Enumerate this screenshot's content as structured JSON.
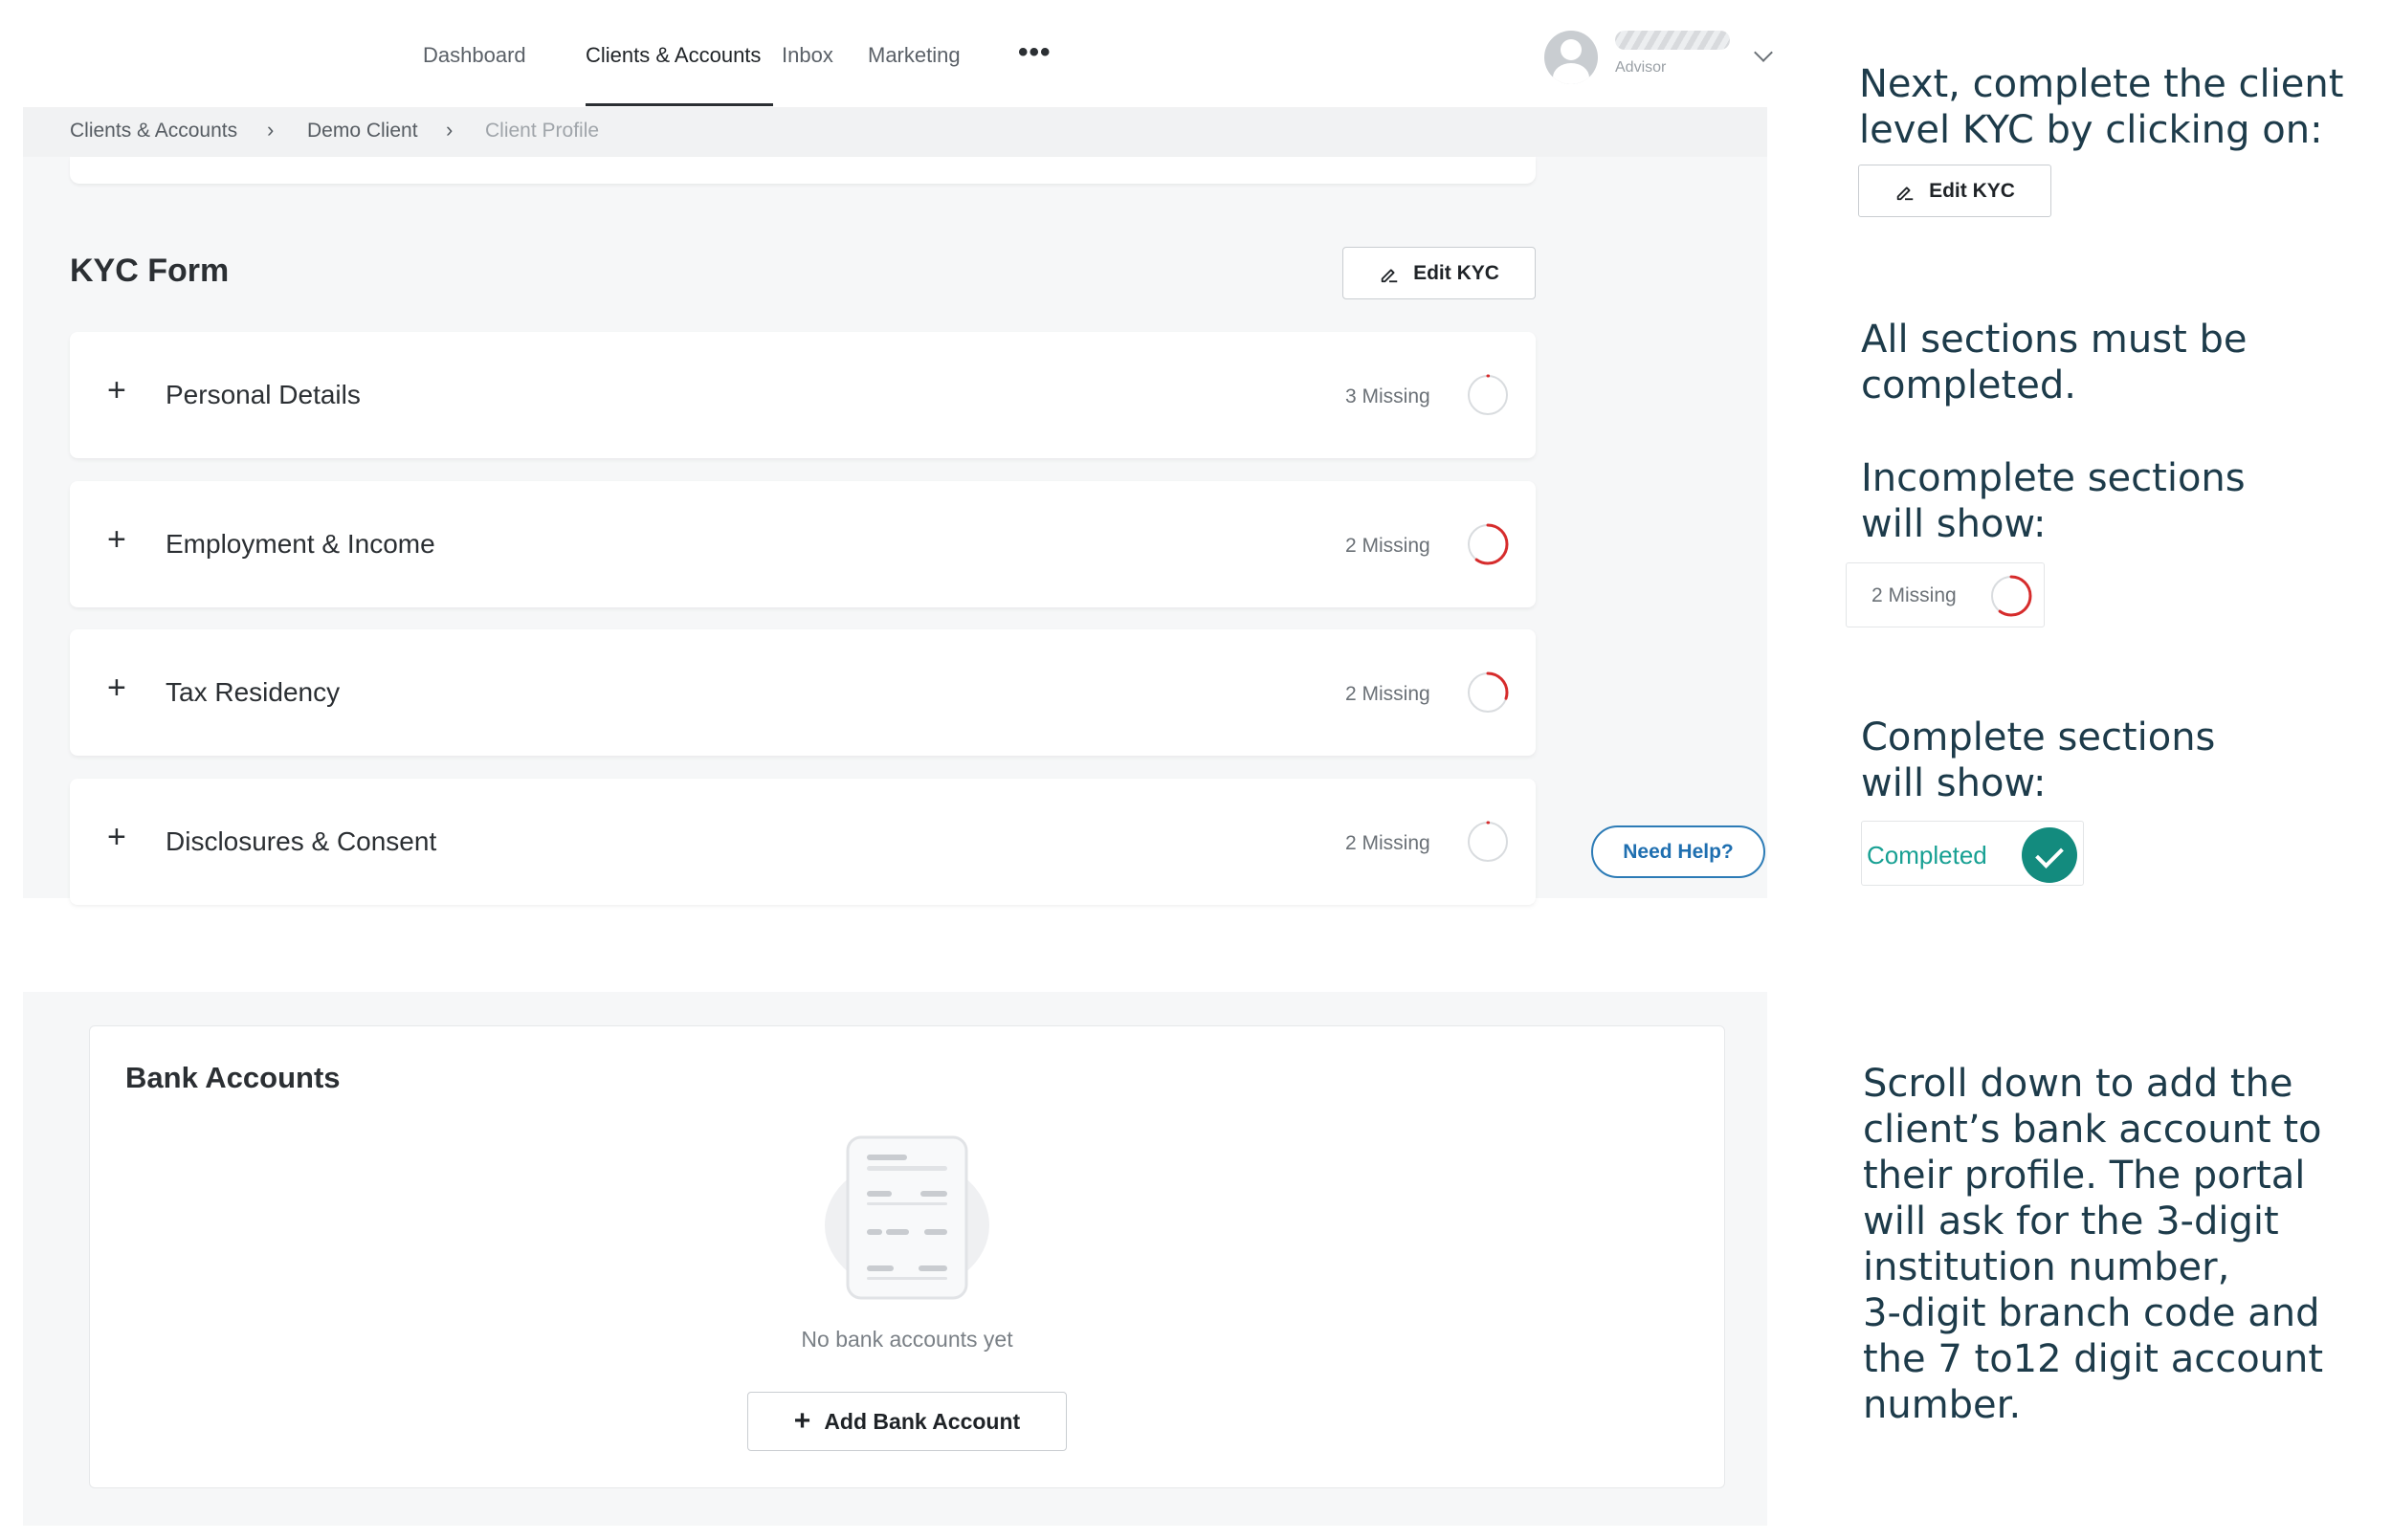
{
  "nav": {
    "items": [
      {
        "label": "Dashboard",
        "active": false
      },
      {
        "label": "Clients & Accounts",
        "active": true
      },
      {
        "label": "Inbox",
        "active": false
      },
      {
        "label": "Marketing",
        "active": false
      }
    ],
    "more": "•••",
    "user_role": "Advisor",
    "icons": [
      "user-avatar-icon",
      "chevron-down-icon",
      "more-horizontal-icon"
    ]
  },
  "breadcrumb": {
    "items": [
      "Clients & Accounts",
      "Demo Client",
      "Client Profile"
    ],
    "separator": "›"
  },
  "kyc": {
    "title": "KYC Form",
    "edit_label": "Edit KYC",
    "sections": [
      {
        "label": "Personal Details",
        "missing": "3 Missing",
        "progress": 0.0
      },
      {
        "label": "Employment & Income",
        "missing": "2 Missing",
        "progress": 0.6
      },
      {
        "label": "Tax Residency",
        "missing": "2 Missing",
        "progress": 0.3
      },
      {
        "label": "Disclosures & Consent",
        "missing": "2 Missing",
        "progress": 0.0
      }
    ],
    "expand_symbol": "+"
  },
  "help": {
    "label": "Need Help?"
  },
  "bank": {
    "title": "Bank Accounts",
    "empty_text": "No bank accounts yet",
    "add_label": "Add Bank Account",
    "add_symbol": "+"
  },
  "instructions": {
    "step1": "Next, complete the client\nlevel KYC by clicking on:",
    "edit_label": "Edit KYC",
    "step2": "All sections must be\ncompleted.",
    "step3": "Incomplete sections\nwill show:",
    "missing_example": "2 Missing",
    "missing_progress": 0.6,
    "step4": "Complete sections\nwill show:",
    "completed_example": "Completed",
    "step5": "Scroll down to add the\nclient’s bank account to\ntheir profile. The portal\nwill ask for the 3-digit\ninstitution number,\n3-digit branch code and\nthe 7 to12 digit account\nnumber."
  },
  "colors": {
    "ring_track": "#d9dcdf",
    "ring_progress": "#d62c2c",
    "completed_green": "#138b7e",
    "help_blue": "#2c7bb6",
    "instruction_text": "#1d3b4a"
  }
}
